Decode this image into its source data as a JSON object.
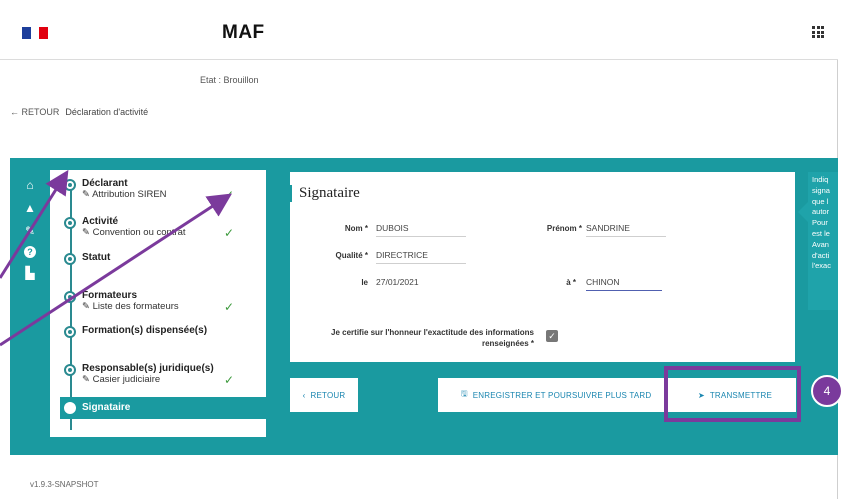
{
  "header": {
    "app_title": "MAF",
    "flag_icon": "french-flag-icon",
    "apps_icon": "apps-grid-icon"
  },
  "status": {
    "state": "Etat : Brouillon"
  },
  "breadcrumb": {
    "back": "← RETOUR",
    "title": "Déclaration d'activité"
  },
  "sidebar": {
    "icons": [
      "home-icon",
      "graduation-cap-icon",
      "wrench-icon",
      "help-icon",
      "cake-icon"
    ],
    "help_glyph": "?"
  },
  "steps": [
    {
      "label": "Déclarant",
      "sub": "✎ Attribution SIREN",
      "done": true
    },
    {
      "label": "Activité",
      "sub": "✎ Convention ou contrat",
      "done": true
    },
    {
      "label": "Statut",
      "sub": "",
      "done": false
    },
    {
      "label": "Formateurs",
      "sub": "✎ Liste des formateurs",
      "done": true
    },
    {
      "label": "Formation(s) dispensée(s)",
      "sub": "",
      "done": false
    },
    {
      "label": "Responsable(s) juridique(s)",
      "sub": "✎ Casier judiciaire",
      "done": true
    },
    {
      "label": "Signataire",
      "sub": "",
      "active": true
    }
  ],
  "check_glyph": "✓",
  "form": {
    "title": "Signataire",
    "nom_label": "Nom *",
    "nom_value": "DUBOIS",
    "prenom_label": "Prénom *",
    "prenom_value": "SANDRINE",
    "qualite_label": "Qualité *",
    "qualite_value": "DIRECTRICE",
    "le_label": "le",
    "le_value": "27/01/2021",
    "a_label": "à *",
    "a_value": "CHINON",
    "certify_label_1": "Je certifie sur l'honneur l'exactitude des informations",
    "certify_label_2": "renseignées *",
    "certify_checked": true,
    "checkbox_glyph": "✓"
  },
  "buttons": {
    "retour": "RETOUR",
    "retour_icon": "‹",
    "save": "ENREGISTRER ET POURSUIVRE PLUS TARD",
    "save_icon": "🖫",
    "transmit": "TRANSMETTRE",
    "transmit_icon": "➤"
  },
  "annotation": {
    "badge": "4",
    "color": "#7b3a9c"
  },
  "hint": {
    "lines": [
      "Indiq",
      "signa",
      "que l",
      "autor",
      "Pour",
      "est le",
      "Avan",
      "d'acti",
      "l'exac"
    ]
  },
  "footer": {
    "version": "v1.9.3-SNAPSHOT"
  },
  "colors": {
    "teal": "#1a9aa0",
    "link": "#1a86b0",
    "check": "#3c9a3c"
  }
}
